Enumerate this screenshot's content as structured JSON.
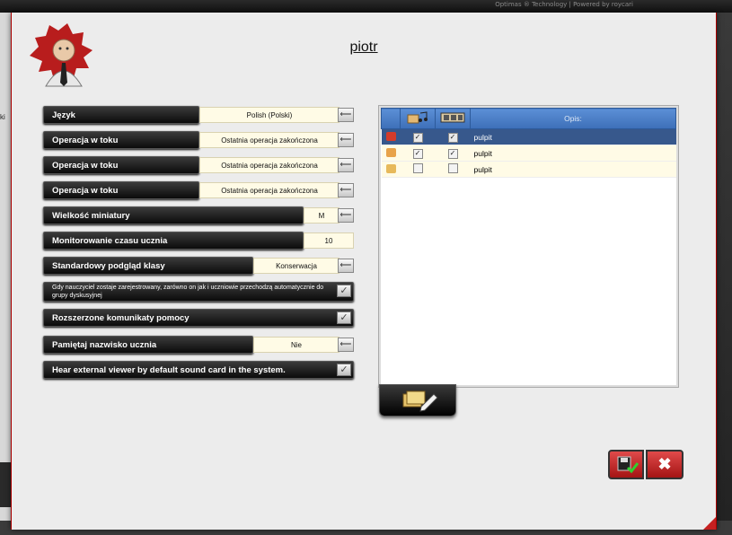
{
  "app": {
    "credits": "Optimas ® Technology  |  Powered by  roycari",
    "left_fragment": "ki"
  },
  "dialog": {
    "title": "piotr"
  },
  "settings": [
    {
      "label": "Język",
      "value": "Polish (Polski)",
      "control": "dropdown"
    },
    {
      "label": "Operacja w toku",
      "value": "Ostatnia operacja zakończona",
      "control": "dropdown"
    },
    {
      "label": "Operacja w toku",
      "value": "Ostatnia operacja zakończona",
      "control": "dropdown"
    },
    {
      "label": "Operacja w toku",
      "value": "Ostatnia operacja zakończona",
      "control": "dropdown"
    },
    {
      "label": "Wielkość miniatury",
      "value": "M",
      "control": "dropdown"
    },
    {
      "label": "Monitorowanie czasu ucznia",
      "value": "10",
      "control": "input"
    },
    {
      "label": "Standardowy podgląd klasy",
      "value": "Konserwacja",
      "control": "dropdown"
    },
    {
      "label": "Gdy nauczyciel zostaje zarejestrowany, zarówno on jak i uczniowie przechodzą automatycznie do grupy dyskusyjnej",
      "control": "checkbox"
    },
    {
      "label": "Rozszerzone komunikaty pomocy",
      "control": "checkbox"
    },
    {
      "label": "Pamiętaj nazwisko ucznia",
      "value": "Nie",
      "control": "dropdown"
    },
    {
      "label": "Hear external viewer by default sound card in the system.",
      "control": "checkbox"
    }
  ],
  "table": {
    "headers": [
      "",
      "",
      "",
      "Opis:"
    ],
    "rows": [
      {
        "icon": "red",
        "audio": true,
        "video": true,
        "desc": "pulpit",
        "selected": true
      },
      {
        "icon": "orange",
        "audio": true,
        "video": true,
        "desc": "pulpit",
        "selected": false
      },
      {
        "icon": "yellow",
        "audio": false,
        "video": false,
        "desc": "pulpit",
        "selected": false
      }
    ]
  },
  "icons": {
    "check": "✓",
    "arrow": "⟵",
    "close": "✖",
    "audio_header": "music-note-icon",
    "video_header": "film-icon",
    "edit": "pencil-folder-icon",
    "save": "save-icon"
  },
  "colors": {
    "accent": "#c62020",
    "header_blue": "#3d6fb8",
    "selected_row": "#37588c"
  }
}
